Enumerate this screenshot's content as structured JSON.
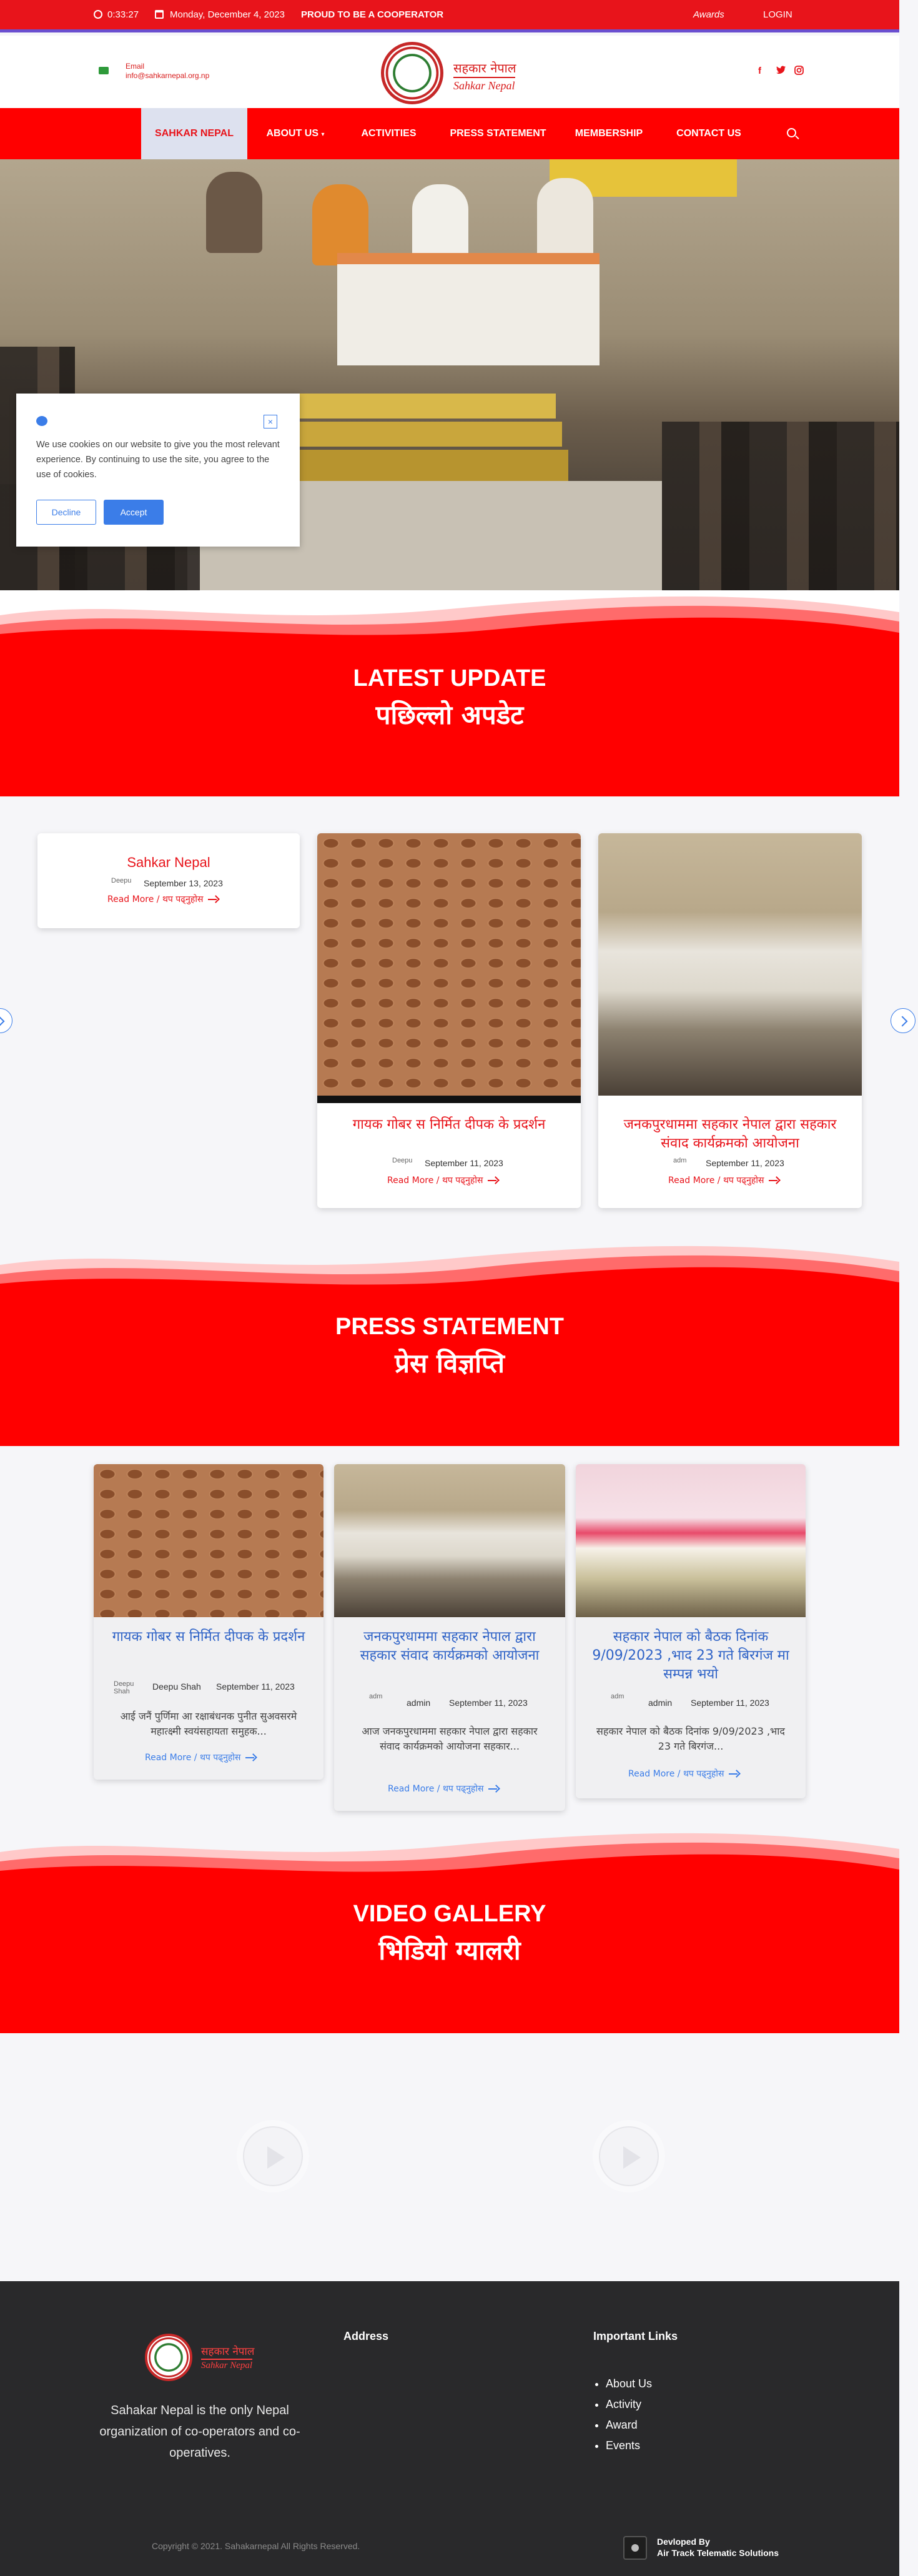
{
  "topbar": {
    "time": "0:33:27",
    "date": "Monday, December 4, 2023",
    "tagline": "PROUD TO BE A COOPERATOR",
    "awards": "Awards",
    "login": "LOGIN"
  },
  "header": {
    "email_label": "Email",
    "email_value": "info@sahkarnepal.org.np",
    "logo_np": "सहकार नेपाल",
    "logo_en": "Sahkar Nepal",
    "social": [
      "f",
      "t",
      "ig"
    ]
  },
  "nav": {
    "items": [
      "SAHKAR NEPAL",
      "ABOUT US",
      "ACTIVITIES",
      "PRESS STATEMENT",
      "MEMBERSHIP",
      "CONTACT US"
    ]
  },
  "cookie": {
    "text": "We use cookies on our website to give you the most relevant experience. By continuing to use the site, you agree to the use of cookies.",
    "close": "×",
    "decline": "Decline",
    "accept": "Accept"
  },
  "latest": {
    "title_en": "LATEST UPDATE",
    "title_np": "पछिल्लो अपडेट",
    "cards": [
      {
        "title": "Sahkar Nepal",
        "date": "September 13, 2023",
        "avatar_alt": "Deepu",
        "read_more": "Read More / थप पढ्नुहोस"
      },
      {
        "title": "गायक गोबर स निर्मित दीपक के प्रदर्शन",
        "date": "September 11, 2023",
        "avatar_alt": "Deepu",
        "read_more": "Read More / थप पढ्नुहोस"
      },
      {
        "title": "जनकपुरधाममा सहकार नेपाल द्वारा सहकार संवाद कार्यक्रमको आयोजना",
        "date": "September 11, 2023",
        "avatar_alt": "adm",
        "read_more": "Read More / थप पढ्नुहोस"
      }
    ]
  },
  "press": {
    "title_en": "PRESS STATEMENT",
    "title_np": "प्रेस विज्ञप्ति",
    "cards": [
      {
        "title": "गायक गोबर स निर्मित दीपक के प्रदर्शन",
        "avatar_alt": "Deepu Shah",
        "author": "Deepu Shah",
        "date": "September 11, 2023",
        "excerpt": "आई जनैं पुर्णिमा आ रक्षाबंधनक पुनीत सुअवसरमे महात्क्ष्मी स्वयंसहायता समुहक...",
        "read_more": "Read More / थप पढ्नुहोस"
      },
      {
        "title": "जनकपुरधाममा सहकार नेपाल द्वारा सहकार संवाद कार्यक्रमको आयोजना",
        "avatar_alt": "adm",
        "author": "admin",
        "date": "September 11, 2023",
        "excerpt": "आज जनकपुरधाममा सहकार नेपाल द्वारा सहकार संवाद कार्यक्रमको आयोजना सहकार...",
        "read_more": "Read More / थप पढ्नुहोस"
      },
      {
        "title": "सहकार नेपाल को बैठक दिनांक 9/09/2023 ,भाद 23 गते बिरगंज मा सम्पन्न भयो",
        "avatar_alt": "adm",
        "author": "admin",
        "date": "September 11, 2023",
        "excerpt": "सहकार नेपाल को बैठक दिनांक 9/09/2023 ,भाद 23 गते बिरगंज...",
        "read_more": "Read More / थप पढ्नुहोस"
      }
    ]
  },
  "video": {
    "title_en": "VIDEO GALLERY",
    "title_np": "भिडियो ग्यालरी"
  },
  "footer": {
    "logo_np": "सहकार नेपाल",
    "logo_en": "Sahkar Nepal",
    "description": "Sahakar Nepal is the only Nepal organization of co-operators and co-operatives.",
    "address_heading": "Address",
    "links_heading": "Important Links",
    "links": [
      "About Us",
      "Activity",
      "Award",
      "Events"
    ],
    "copyright": "Copyright © 2021. Sahakarnepal All Rights Reserved.",
    "dev_label": "Devloped By",
    "dev_name": "Air Track Telematic Solutions"
  },
  "colors": {
    "primary_red": "#ff0000",
    "accent_blue": "#3b7de8",
    "topbar_border": "#6a4fd0",
    "footer_bg": "#29292b"
  }
}
